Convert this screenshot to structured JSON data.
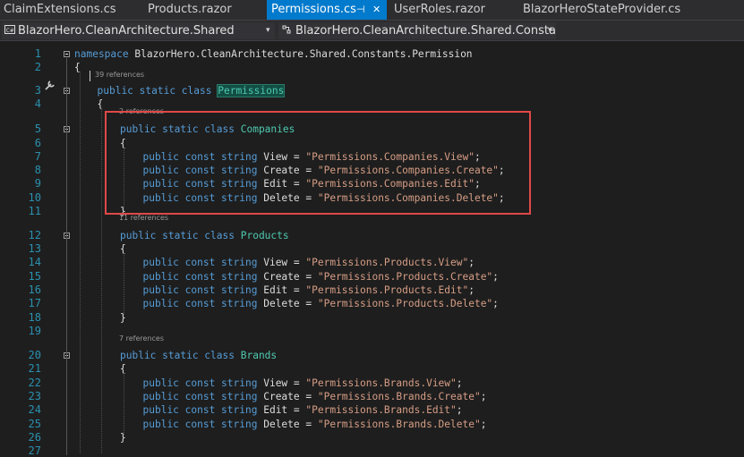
{
  "tabs": [
    {
      "label": "ClaimExtensions.cs"
    },
    {
      "label": "Products.razor"
    },
    {
      "label": "Permissions.cs",
      "pin": "⊣"
    },
    {
      "label": "UserRoles.razor"
    },
    {
      "label": "BlazorHeroStateProvider.cs"
    }
  ],
  "nav": {
    "project": "BlazorHero.CleanArchitecture.Shared",
    "type_dropdown": "BlazorHero.CleanArchitecture.Shared.Constants"
  },
  "lens": {
    "l3": "39 references",
    "l5": "2 references",
    "l12": "11 references",
    "l20": "7 references"
  },
  "lines": [
    {
      "n": "1",
      "parts": [
        {
          "t": "namespace",
          "c": "kw"
        },
        {
          "t": " BlazorHero.CleanArchitecture.Shared.Constants.Permission"
        }
      ]
    },
    {
      "n": "2",
      "parts": [
        {
          "t": "{"
        }
      ]
    },
    {
      "n": "3",
      "parts": [
        {
          "t": "public static class",
          "c": "kw"
        },
        {
          "t": " "
        },
        {
          "t": "Permissions",
          "c": "ty hl"
        }
      ]
    },
    {
      "n": "4",
      "parts": [
        {
          "t": "{"
        }
      ]
    },
    {
      "n": "5",
      "parts": [
        {
          "t": "public static class",
          "c": "kw"
        },
        {
          "t": " "
        },
        {
          "t": "Companies",
          "c": "ty"
        }
      ]
    },
    {
      "n": "6",
      "parts": [
        {
          "t": "{"
        }
      ]
    },
    {
      "n": "7",
      "parts": [
        {
          "t": "public const string",
          "c": "kw"
        },
        {
          "t": " View = "
        },
        {
          "t": "\"Permissions.Companies.View\"",
          "c": "str"
        },
        {
          "t": ";"
        }
      ]
    },
    {
      "n": "8",
      "parts": [
        {
          "t": "public const string",
          "c": "kw"
        },
        {
          "t": " Create = "
        },
        {
          "t": "\"Permissions.Companies.Create\"",
          "c": "str"
        },
        {
          "t": ";"
        }
      ]
    },
    {
      "n": "9",
      "parts": [
        {
          "t": "public const string",
          "c": "kw"
        },
        {
          "t": " Edit = "
        },
        {
          "t": "\"Permissions.Companies.Edit\"",
          "c": "str"
        },
        {
          "t": ";"
        }
      ]
    },
    {
      "n": "10",
      "parts": [
        {
          "t": "public const string",
          "c": "kw"
        },
        {
          "t": " Delete = "
        },
        {
          "t": "\"Permissions.Companies.Delete\"",
          "c": "str"
        },
        {
          "t": ";"
        }
      ]
    },
    {
      "n": "11",
      "parts": [
        {
          "t": "}"
        }
      ]
    },
    {
      "n": "12",
      "parts": [
        {
          "t": "public static class",
          "c": "kw"
        },
        {
          "t": " "
        },
        {
          "t": "Products",
          "c": "ty"
        }
      ]
    },
    {
      "n": "13",
      "parts": [
        {
          "t": "{"
        }
      ]
    },
    {
      "n": "14",
      "parts": [
        {
          "t": "public const string",
          "c": "kw"
        },
        {
          "t": " View = "
        },
        {
          "t": "\"Permissions.Products.View\"",
          "c": "str"
        },
        {
          "t": ";"
        }
      ]
    },
    {
      "n": "15",
      "parts": [
        {
          "t": "public const string",
          "c": "kw"
        },
        {
          "t": " Create = "
        },
        {
          "t": "\"Permissions.Products.Create\"",
          "c": "str"
        },
        {
          "t": ";"
        }
      ]
    },
    {
      "n": "16",
      "parts": [
        {
          "t": "public const string",
          "c": "kw"
        },
        {
          "t": " Edit = "
        },
        {
          "t": "\"Permissions.Products.Edit\"",
          "c": "str"
        },
        {
          "t": ";"
        }
      ]
    },
    {
      "n": "17",
      "parts": [
        {
          "t": "public const string",
          "c": "kw"
        },
        {
          "t": " Delete = "
        },
        {
          "t": "\"Permissions.Products.Delete\"",
          "c": "str"
        },
        {
          "t": ";"
        }
      ]
    },
    {
      "n": "18",
      "parts": [
        {
          "t": "}"
        }
      ]
    },
    {
      "n": "19",
      "parts": []
    },
    {
      "n": "20",
      "parts": [
        {
          "t": "public static class",
          "c": "kw"
        },
        {
          "t": " "
        },
        {
          "t": "Brands",
          "c": "ty"
        }
      ]
    },
    {
      "n": "21",
      "parts": [
        {
          "t": "{"
        }
      ]
    },
    {
      "n": "22",
      "parts": [
        {
          "t": "public const string",
          "c": "kw"
        },
        {
          "t": " View = "
        },
        {
          "t": "\"Permissions.Brands.View\"",
          "c": "str"
        },
        {
          "t": ";"
        }
      ]
    },
    {
      "n": "23",
      "parts": [
        {
          "t": "public const string",
          "c": "kw"
        },
        {
          "t": " Create = "
        },
        {
          "t": "\"Permissions.Brands.Create\"",
          "c": "str"
        },
        {
          "t": ";"
        }
      ]
    },
    {
      "n": "24",
      "parts": [
        {
          "t": "public const string",
          "c": "kw"
        },
        {
          "t": " Edit = "
        },
        {
          "t": "\"Permissions.Brands.Edit\"",
          "c": "str"
        },
        {
          "t": ";"
        }
      ]
    },
    {
      "n": "25",
      "parts": [
        {
          "t": "public const string",
          "c": "kw"
        },
        {
          "t": " Delete = "
        },
        {
          "t": "\"Permissions.Brands.Delete\"",
          "c": "str"
        },
        {
          "t": ";"
        }
      ]
    },
    {
      "n": "26",
      "parts": [
        {
          "t": "}"
        }
      ]
    },
    {
      "n": "27",
      "parts": []
    }
  ],
  "colors": {
    "accent": "#007acc",
    "highlight_box": "#e04848",
    "keyword": "#569cd6",
    "type": "#4ec9b0",
    "string": "#d69d85",
    "line_number": "#2b91af"
  }
}
